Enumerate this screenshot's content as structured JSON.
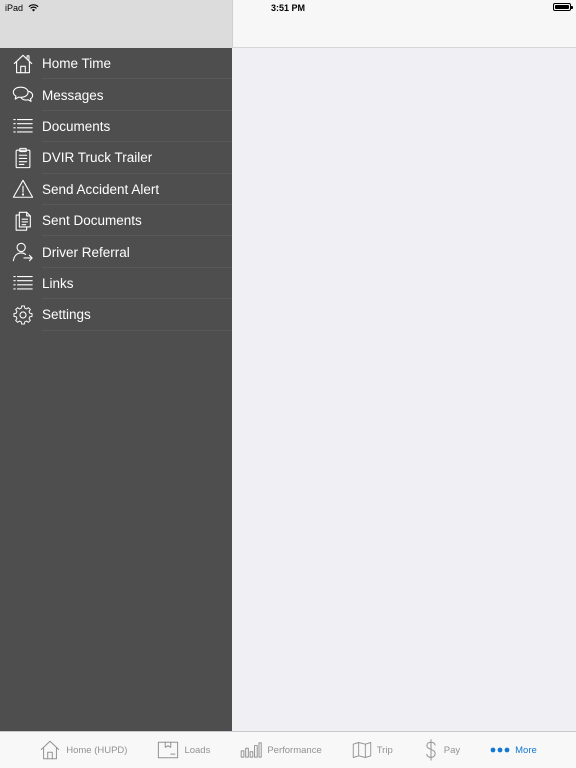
{
  "status": {
    "device": "iPad",
    "time": "3:51 PM"
  },
  "sidebar": {
    "items": [
      {
        "label": "Home Time",
        "icon": "home-icon"
      },
      {
        "label": "Messages",
        "icon": "chat-bubbles-icon"
      },
      {
        "label": "Documents",
        "icon": "list-icon"
      },
      {
        "label": "DVIR Truck Trailer",
        "icon": "clipboard-icon"
      },
      {
        "label": "Send Accident Alert",
        "icon": "warning-icon"
      },
      {
        "label": "Sent Documents",
        "icon": "documents-icon"
      },
      {
        "label": "Driver Referral",
        "icon": "user-share-icon"
      },
      {
        "label": "Links",
        "icon": "list-icon"
      },
      {
        "label": "Settings",
        "icon": "gear-icon"
      }
    ]
  },
  "tabbar": {
    "tabs": [
      {
        "label": "Home (HUPD)",
        "icon": "home-icon"
      },
      {
        "label": "Loads",
        "icon": "box-icon"
      },
      {
        "label": "Performance",
        "icon": "bar-chart-icon"
      },
      {
        "label": "Trip",
        "icon": "map-icon"
      },
      {
        "label": "Pay",
        "icon": "dollar-icon"
      },
      {
        "label": "More",
        "icon": "more-dots-icon",
        "active": true
      }
    ]
  },
  "colors": {
    "sidebar": "#4e4e4e",
    "accent": "#1478d2",
    "tab_inactive": "#929292"
  }
}
